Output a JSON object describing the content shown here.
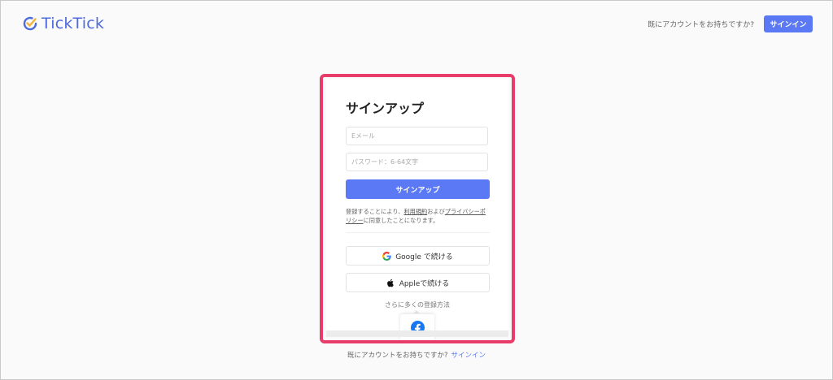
{
  "header": {
    "logo_text": "TickTick",
    "have_account_question": "既にアカウントをお持ちですか?",
    "signin_button": "サインイン"
  },
  "signup_card": {
    "title": "サインアップ",
    "email_placeholder": "Eメール",
    "password_placeholder": "パスワード：6-64文字",
    "signup_button": "サインアップ",
    "terms_prefix": "登録することにより、",
    "terms_link": "利用規約",
    "terms_middle": "および",
    "privacy_link": "プライバシーポリシー",
    "terms_suffix": "に同意したことになります。",
    "google_button": "Google で続ける",
    "apple_button": "Appleで続ける",
    "more_methods": "さらに多くの登録方法"
  },
  "footer": {
    "have_account_question": "既にアカウントをお持ちですか?",
    "signin_link": "サインイン"
  },
  "colors": {
    "accent": "#5b79f5",
    "highlight_border": "#e83c6a",
    "logo": "#4d6bdc",
    "facebook": "#1877f2"
  },
  "icons": [
    "ticktick-logo-icon",
    "google-icon",
    "apple-icon",
    "facebook-icon"
  ]
}
